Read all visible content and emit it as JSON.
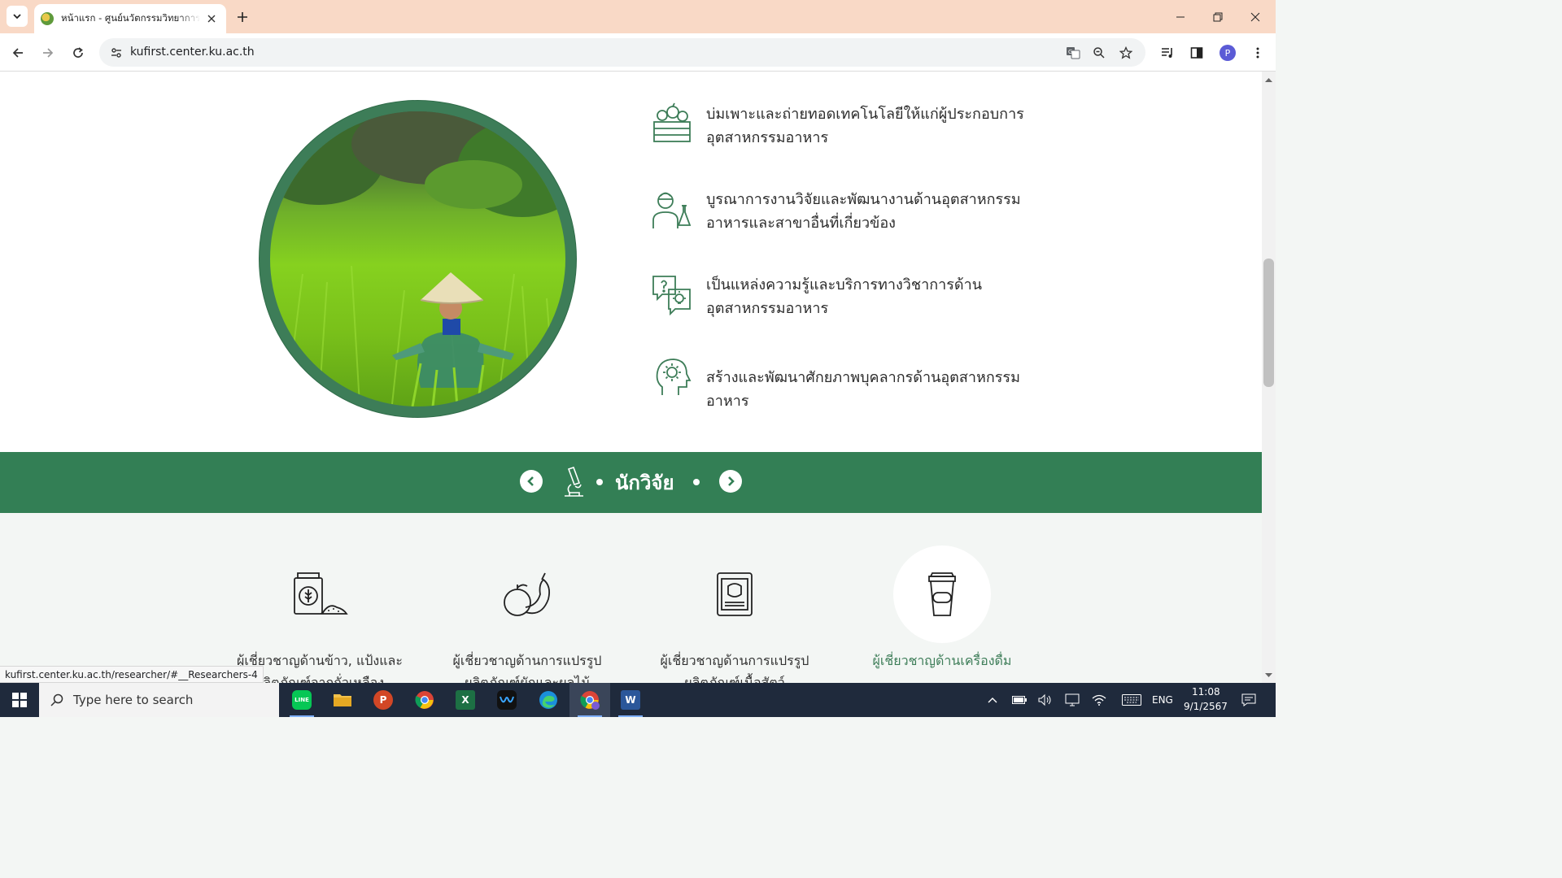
{
  "browser": {
    "tab_title": "หน้าแรก - ศูนย์นวัตกรรมวิทยาการอาหาร",
    "url": "kufirst.center.ku.ac.th",
    "profile_initial": "P",
    "status_url": "kufirst.center.ku.ac.th/researcher/#__Researchers-4"
  },
  "features": [
    {
      "icon": "vegetable-crate-icon",
      "text": "บ่มเพาะและถ่ายทอดเทคโนโลยีให้แก่ผู้ประกอบการอุตสาหกรรมอาหาร"
    },
    {
      "icon": "scientist-icon",
      "text": "บูรณาการงานวิจัยและพัฒนางานด้านอุตสาหกรรมอาหารและสาขาอื่นที่เกี่ยวข้อง"
    },
    {
      "icon": "knowledge-chat-icon",
      "text": "เป็นแหล่งความรู้และบริการทางวิชาการด้านอุตสาหกรรมอาหาร"
    },
    {
      "icon": "head-gear-icon",
      "text": "สร้างและพัฒนาศักยภาพบุคลากรด้านอุตสาหกรรมอาหาร"
    }
  ],
  "researchers": {
    "title": "นักวิจัย",
    "experts": [
      {
        "icon": "rice-flour-icon",
        "label": "ผู้เชี่ยวชาญด้านข้าว, แป้งและผลิตภัณฑ์จากถั่วเหลือง"
      },
      {
        "icon": "fruit-vegetable-icon",
        "label": "ผู้เชี่ยวชาญด้านการแปรรูปผลิตภัณฑ์ผักและผลไม้"
      },
      {
        "icon": "canned-meat-icon",
        "label": "ผู้เชี่ยวชาญด้านการแปรรูปผลิตภัณฑ์เนื้อสัตว์"
      },
      {
        "icon": "coffee-cup-icon",
        "label": "ผู้เชี่ยวชาญด้านเครื่องดื่ม"
      }
    ]
  },
  "taskbar": {
    "search_placeholder": "Type here to search",
    "language": "ENG",
    "time": "11:08",
    "date": "9/1/2567"
  },
  "colors": {
    "brand_green": "#337f55",
    "chrome_tab_bar": "#f9d9c6",
    "taskbar": "#1f2a3c"
  }
}
